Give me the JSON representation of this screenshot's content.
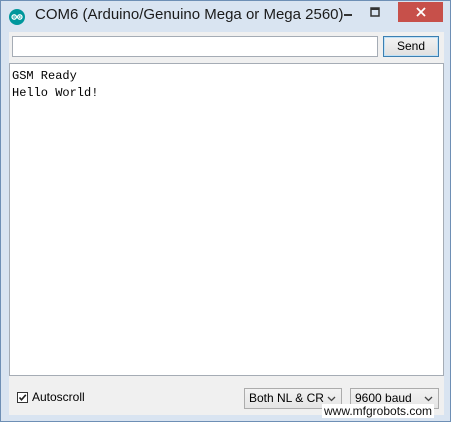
{
  "window": {
    "title": "COM6 (Arduino/Genuino Mega or Mega 2560)",
    "icon": "arduino-logo-icon",
    "controls": [
      "minimize-icon",
      "maximize-icon",
      "close-icon"
    ]
  },
  "input": {
    "value": "",
    "send_label": "Send"
  },
  "output": {
    "lines": [
      "GSM Ready",
      "Hello World!"
    ]
  },
  "footer": {
    "autoscroll_label": "Autoscroll",
    "autoscroll_checked": true,
    "line_ending": "Both NL & CR",
    "baud_rate": "9600 baud"
  },
  "watermark": "www.mfgrobots.com",
  "colors": {
    "close_button": "#c7504a",
    "frame": "#d9e4f1",
    "arduino_teal": "#00979c"
  }
}
